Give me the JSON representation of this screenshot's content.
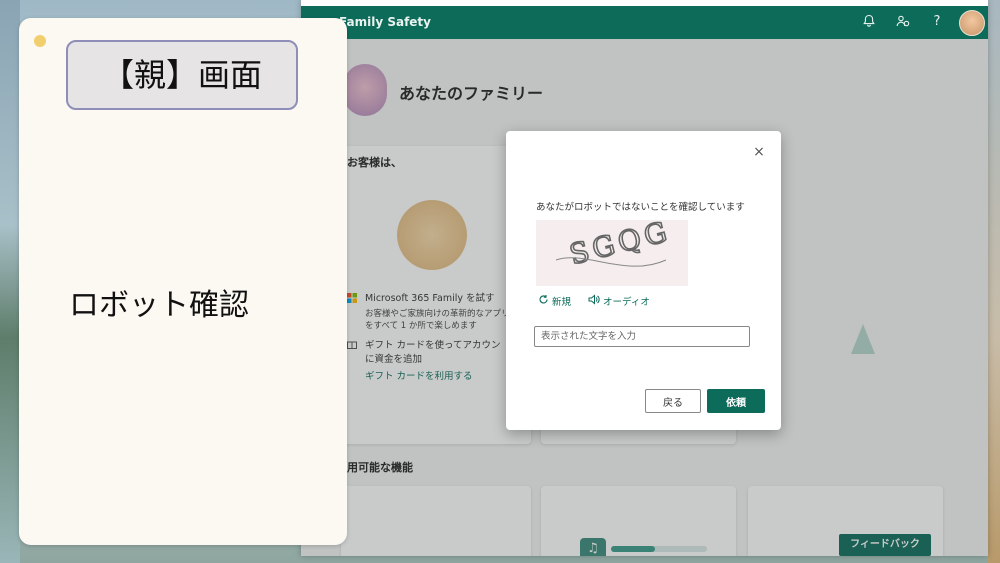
{
  "panel": {
    "title": "【親】画面",
    "subtitle": "ロボット確認"
  },
  "app": {
    "brand": "Family Safety",
    "header_icons": [
      "bell-icon",
      "family-settings-icon",
      "help-icon"
    ],
    "help_glyph": "?",
    "family_title": "あなたのファミリー",
    "card1": {
      "heading": "お客様は、",
      "items": [
        {
          "icon": "microsoft-logo-icon",
          "title": "Microsoft 365 Family を試す",
          "desc1": "お客様やご家族向けの革新的なアプリ",
          "desc2": "をすべて 1 か所で楽しめます"
        },
        {
          "icon": "gift-card-icon",
          "title": "ギフト カードを使ってアカウン",
          "desc1": "に資金を追加"
        }
      ],
      "link": "ギフト カードを利用する"
    },
    "section2": "用可能な機能",
    "feedback": "フィードバック",
    "music_glyph": "♫"
  },
  "modal": {
    "close": "×",
    "prompt": "あなたがロボットではないことを確認しています",
    "captcha_text": "SGQG",
    "new_label": "新規",
    "audio_label": "オーディオ",
    "input_placeholder": "表示された文字を入力",
    "back_label": "戻る",
    "request_label": "依頼"
  },
  "colors": {
    "brand_green": "#0d6b5a",
    "panel_bg": "#fcf9f3",
    "title_border": "#8e8eb8"
  }
}
